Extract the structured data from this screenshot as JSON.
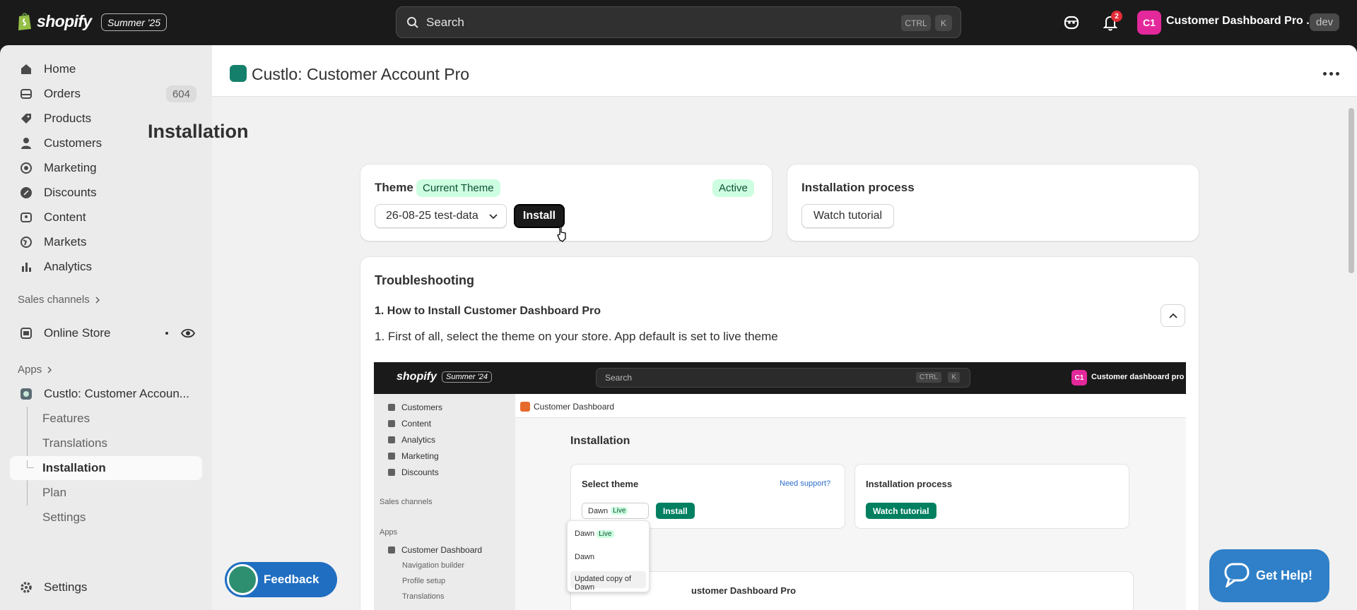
{
  "topbar": {
    "brand": "shopify",
    "edition": "Summer '25",
    "search_placeholder": "Search",
    "kbd_ctrl": "CTRL",
    "kbd_k": "K",
    "notification_count": "2",
    "avatar_initials": "C1",
    "store_name": "Customer Dashboard Pro ...",
    "env_badge": "dev"
  },
  "sidebar": {
    "items": [
      {
        "label": "Home",
        "icon": "home-icon"
      },
      {
        "label": "Orders",
        "icon": "orders-icon",
        "count": "604"
      },
      {
        "label": "Products",
        "icon": "tag-icon"
      },
      {
        "label": "Customers",
        "icon": "person-icon"
      },
      {
        "label": "Marketing",
        "icon": "target-icon"
      },
      {
        "label": "Discounts",
        "icon": "discount-icon"
      },
      {
        "label": "Content",
        "icon": "image-icon"
      },
      {
        "label": "Markets",
        "icon": "globe-icon"
      },
      {
        "label": "Analytics",
        "icon": "bar-chart-icon"
      }
    ],
    "sales_channels_label": "Sales channels",
    "online_store_label": "Online Store",
    "apps_label": "Apps",
    "app_name": "Custlo: Customer Accoun...",
    "app_subitems": [
      "Features",
      "Translations",
      "Installation",
      "Plan",
      "Settings"
    ],
    "active_subitem": "Installation",
    "settings_label": "Settings"
  },
  "app_header": {
    "title": "Custlo: Customer Account Pro"
  },
  "page": {
    "title": "Installation",
    "theme_card": {
      "label": "Theme",
      "current_badge": "Current Theme",
      "status_badge": "Active",
      "selected_theme": "26-08-25 test-data",
      "install_button": "Install"
    },
    "process_card": {
      "label": "Installation process",
      "tutorial_button": "Watch tutorial"
    },
    "troubleshooting": {
      "title": "Troubleshooting",
      "question": "1. How to Install Customer Dashboard Pro",
      "answer": "1. First of all, select the theme on your store. App default is set to live theme"
    }
  },
  "embedded_screenshot": {
    "brand": "shopify",
    "edition": "Summer '24",
    "search": "Search",
    "kbd_ctrl": "CTRL",
    "kbd_k": "K",
    "avatar": "C1",
    "store": "Customer dashboard pro ...",
    "nav": [
      "Customers",
      "Content",
      "Analytics",
      "Marketing",
      "Discounts"
    ],
    "sales_channels": "Sales channels",
    "apps": "Apps",
    "app_name": "Customer Dashboard",
    "app_subitems": [
      "Navigation builder",
      "Profile setup",
      "Translations"
    ],
    "header_title": "Customer Dashboard",
    "page_title": "Installation",
    "select_theme": "Select theme",
    "need_support": "Need support?",
    "theme_value": "Dawn",
    "live_badge": "Live",
    "install": "Install",
    "process_title": "Installation process",
    "watch_tutorial": "Watch tutorial",
    "dropdown_options": [
      "Dawn",
      "Dawn",
      "Updated copy of Dawn"
    ],
    "faq_partial": "ustomer Dashboard Pro"
  },
  "floating": {
    "feedback": "Feedback",
    "get_help": "Get Help!"
  },
  "colors": {
    "accent_green": "#008060",
    "badge_green_bg": "#cdfee1",
    "help_blue": "#2f80c8",
    "avatar_pink": "#e3289b"
  }
}
